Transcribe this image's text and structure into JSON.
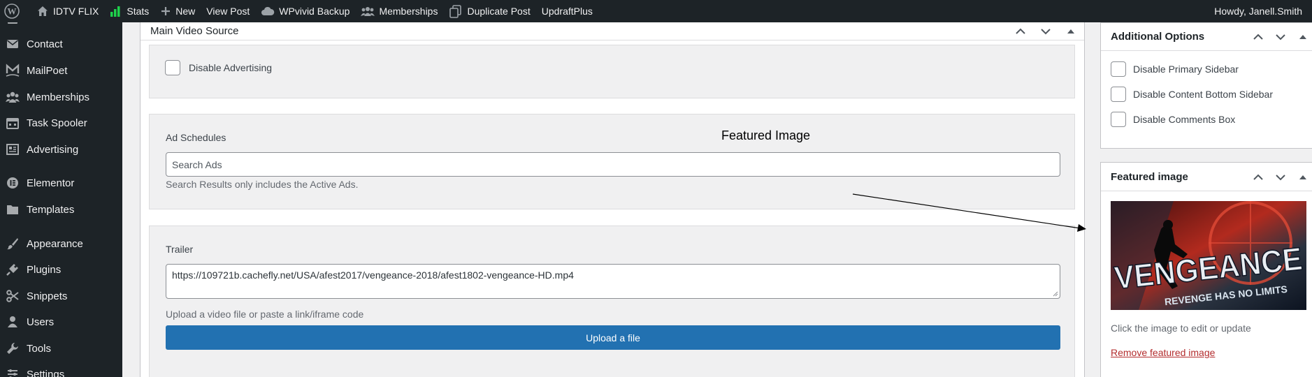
{
  "admin_bar": {
    "site_name": "IDTV FLIX",
    "items": [
      "Stats",
      "New",
      "View Post",
      "WPvivid Backup",
      "Memberships",
      "Duplicate Post",
      "UpdraftPlus"
    ],
    "greeting": "Howdy, Janell.Smith"
  },
  "sidebar": {
    "items": [
      {
        "label": "Contact",
        "icon": "envelope-icon"
      },
      {
        "label": "MailPoet",
        "icon": "mailpoet-icon"
      },
      {
        "label": "Memberships",
        "icon": "groups-icon"
      },
      {
        "label": "Task Spooler",
        "icon": "calendar-icon"
      },
      {
        "label": "Advertising",
        "icon": "ad-icon"
      },
      {
        "label": "Elementor",
        "icon": "elementor-icon"
      },
      {
        "label": "Templates",
        "icon": "folder-icon"
      },
      {
        "label": "Appearance",
        "icon": "brush-icon"
      },
      {
        "label": "Plugins",
        "icon": "plugin-icon"
      },
      {
        "label": "Snippets",
        "icon": "scissors-icon"
      },
      {
        "label": "Users",
        "icon": "user-icon"
      },
      {
        "label": "Tools",
        "icon": "wrench-icon"
      },
      {
        "label": "Settings",
        "icon": "settings-icon"
      }
    ]
  },
  "main": {
    "box_title": "Main Video Source",
    "disable_ads_label": "Disable Advertising",
    "ad_schedules_label": "Ad Schedules",
    "search_ads_placeholder": "Search Ads",
    "search_hint": "Search Results only includes the Active Ads.",
    "trailer_label": "Trailer",
    "trailer_value": "https://109721b.cachefly.net/USA/afest2017/vengeance-2018/afest1802-vengeance-HD.mp4",
    "trailer_hint": "Upload a video file or paste a link/iframe code",
    "upload_button": "Upload a file"
  },
  "additional_options": {
    "title": "Additional Options",
    "options": [
      "Disable Primary Sidebar",
      "Disable Content Bottom Sidebar",
      "Disable Comments Box"
    ]
  },
  "featured_image": {
    "title": "Featured image",
    "poster_title": "VENGEANCE",
    "poster_tagline": "REVENGE HAS NO LIMITS",
    "hint": "Click the image to edit or update",
    "remove_link": "Remove featured image"
  },
  "annotation": {
    "label": "Featured Image"
  },
  "colors": {
    "admin_bar": "#1d2327",
    "accent": "#2271b1",
    "link_danger": "#b32d2e",
    "stats_green": "#1ed14b"
  }
}
